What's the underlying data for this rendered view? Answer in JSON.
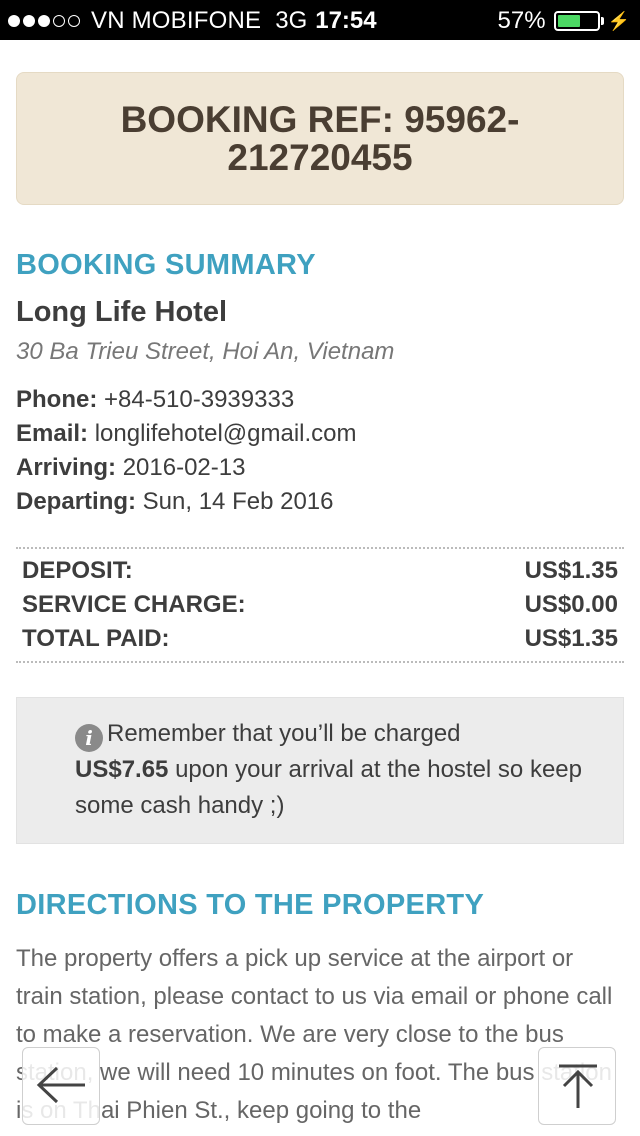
{
  "status_bar": {
    "signal_dots": [
      true,
      true,
      true,
      false,
      false
    ],
    "carrier": "VN MOBIFONE",
    "network": "3G",
    "time": "17:54",
    "battery_percent_label": "57%",
    "battery_level": 0.57,
    "battery_color": "#4cd964"
  },
  "booking_ref": {
    "label": "BOOKING REF: 95962-212720455"
  },
  "summary": {
    "title": "BOOKING SUMMARY",
    "hotel_name": "Long Life Hotel",
    "address": "30 Ba Trieu Street, Hoi An, Vietnam",
    "info": [
      {
        "label": "Phone:",
        "value": "+84-510-3939333"
      },
      {
        "label": "Email:",
        "value": "longlifehotel@gmail.com"
      },
      {
        "label": "Arriving:",
        "value": "2016-02-13"
      },
      {
        "label": "Departing:",
        "value": "Sun, 14 Feb 2016"
      }
    ]
  },
  "totals": [
    {
      "label": "DEPOSIT:",
      "value": "US$1.35"
    },
    {
      "label": "SERVICE CHARGE:",
      "value": "US$0.00"
    },
    {
      "label": "TOTAL PAID:",
      "value": "US$1.35"
    }
  ],
  "notice": {
    "icon": "info-icon",
    "before": "Remember that you’ll be charged",
    "amount": "US$7.65",
    "after": "upon your arrival at the hostel so keep some cash handy ;)"
  },
  "directions": {
    "title": "DIRECTIONS TO THE PROPERTY",
    "text": "The property offers a pick up service at the airport or train station, please contact to us via email or phone call to make a reservation. We are very close to the bus station, we will need 10 minutes on foot. The bus station is on Thai Phien St., keep going to the"
  },
  "colors": {
    "accent": "#3fa1c0",
    "ref_background": "#f0e7d6",
    "notice_background": "#ececec"
  },
  "floating_buttons": {
    "back_icon": "arrow-left-icon",
    "top_icon": "arrow-up-to-top-icon"
  }
}
